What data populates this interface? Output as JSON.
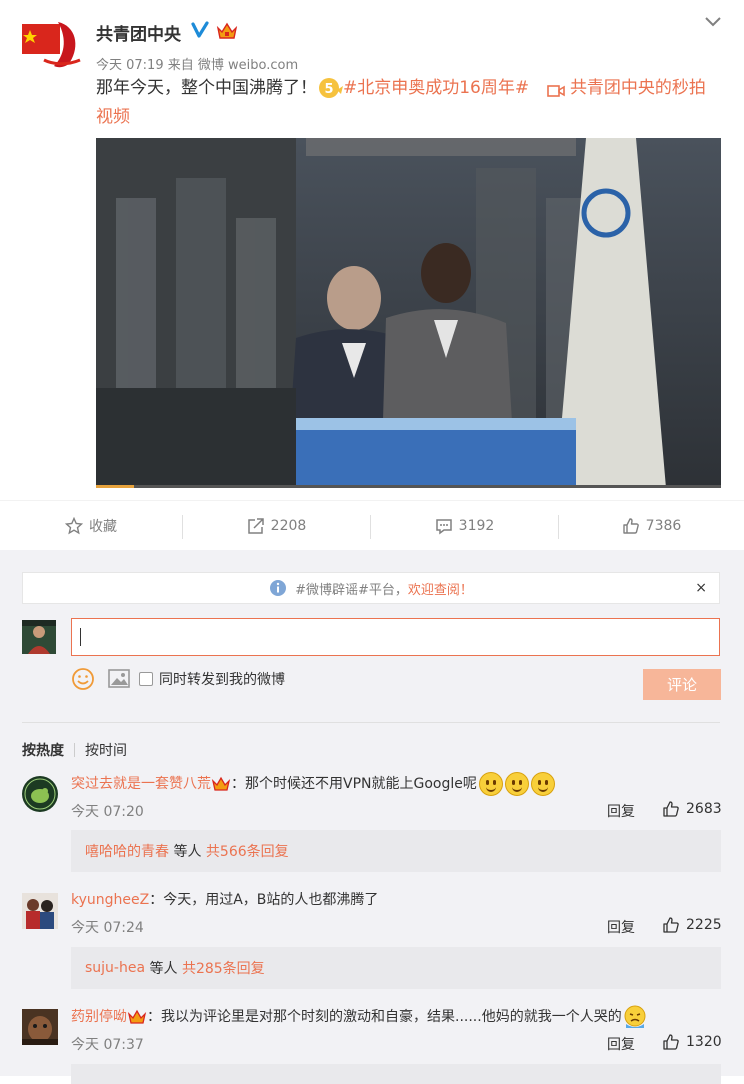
{
  "post": {
    "author": "共青团中央",
    "time": "今天 07:19",
    "source": "来自 微博 weibo.com",
    "text_main": "那年今天，整个中国沸腾了！",
    "hashtag": "#北京申奥成功16周年#",
    "video_link": "共青团中央的秒拍视频",
    "video_progress": 0.06,
    "colors": {
      "accent": "#eb7350",
      "gray_text": "#808080"
    }
  },
  "actions": {
    "favorite": "收藏",
    "repost_count": "2208",
    "comment_count": "3192",
    "like_count": "7386"
  },
  "composer": {
    "notice_tag": "#微博辟谣#平台，",
    "notice_link": "欢迎查阅！",
    "notice_close": "×",
    "sync_label": "同时转发到我的微博",
    "submit_label": "评论"
  },
  "sort": {
    "hot": "按热度",
    "time": "按时间"
  },
  "comments": [
    {
      "user": "突过去就是一套赞八荒",
      "text": "：那个时候还不用VPN就能上Google呢",
      "time": "今天 07:20",
      "reply": "回复",
      "likes": "2683",
      "sub_user": "嘻哈哈的青春",
      "sub_mid": " 等人 ",
      "sub_count": "共566条回复"
    },
    {
      "user": "kyungheeZ",
      "text": "：今天，用过A，B站的人也都沸腾了",
      "time": "今天 07:24",
      "reply": "回复",
      "likes": "2225",
      "sub_user": "suju-hea",
      "sub_mid": " 等人 ",
      "sub_count": "共285条回复"
    },
    {
      "user": "药别停呦",
      "text": "：我以为评论里是对那个时刻的激动和自豪，结果......他妈的就我一个人哭的",
      "time": "今天 07:37",
      "reply": "回复",
      "likes": "1320"
    }
  ]
}
